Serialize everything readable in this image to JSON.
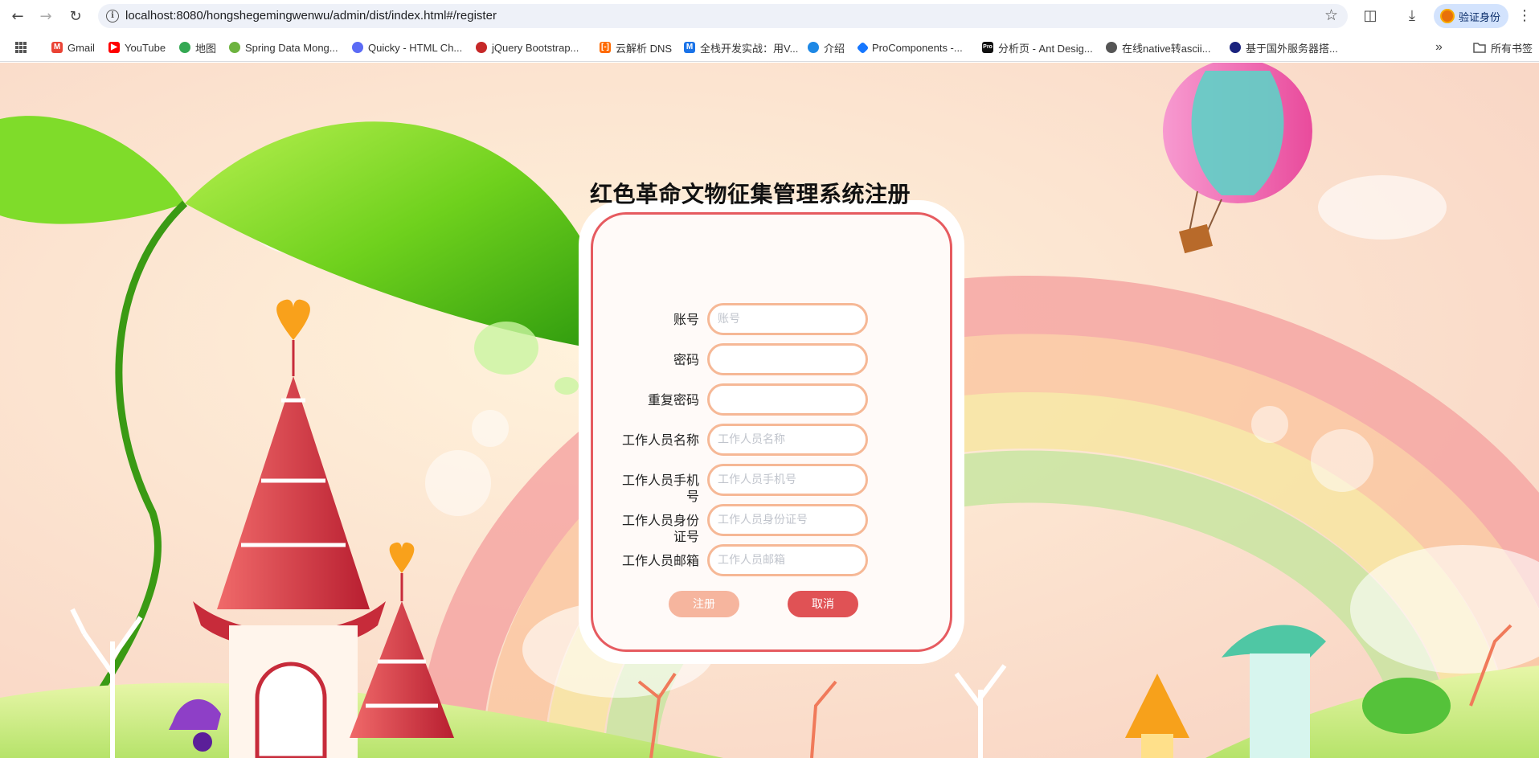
{
  "browser": {
    "url": "localhost:8080/hongshegemingwenwu/admin/dist/index.html#/register",
    "profile_label": "验证身份",
    "bookmarks": [
      {
        "label": "Gmail",
        "color": "#ea4335"
      },
      {
        "label": "YouTube",
        "color": "#ff0000"
      },
      {
        "label": "地图",
        "color": "#34a853"
      },
      {
        "label": "Spring Data Mong...",
        "color": "#6db33f"
      },
      {
        "label": "Quicky - HTML Ch...",
        "color": "#5b6bf5"
      },
      {
        "label": "jQuery Bootstrap...",
        "color": "#c62828"
      },
      {
        "label": "云解析 DNS",
        "color": "#ff6a00"
      },
      {
        "label": "全栈开发实战：用V...",
        "color": "#1a73e8"
      },
      {
        "label": "介绍",
        "color": "#1e88e5"
      },
      {
        "label": "ProComponents -...",
        "color": "#1677ff"
      },
      {
        "label": "分析页 - Ant Desig...",
        "color": "#111111"
      },
      {
        "label": "在线native转ascii...",
        "color": "#555555"
      },
      {
        "label": "基于国外服务器搭...",
        "color": "#1a237e"
      }
    ],
    "all_bookmarks": "所有书签"
  },
  "form": {
    "title": "红色革命文物征集管理系统注册",
    "fields": [
      {
        "label": "账号",
        "placeholder": "账号"
      },
      {
        "label": "密码",
        "placeholder": ""
      },
      {
        "label": "重复密码",
        "placeholder": ""
      },
      {
        "label": "工作人员名称",
        "placeholder": "工作人员名称"
      },
      {
        "label": "工作人员手机号",
        "placeholder": "工作人员手机号"
      },
      {
        "label": "工作人员身份证号",
        "placeholder": "工作人员身份证号"
      },
      {
        "label": "工作人员邮箱",
        "placeholder": "工作人员邮箱"
      }
    ],
    "register_label": "注册",
    "cancel_label": "取消"
  },
  "colors": {
    "accent": "#e65b60",
    "field_border": "#f6b896",
    "register_button": "#f6b59e",
    "cancel_button": "#e05255"
  }
}
